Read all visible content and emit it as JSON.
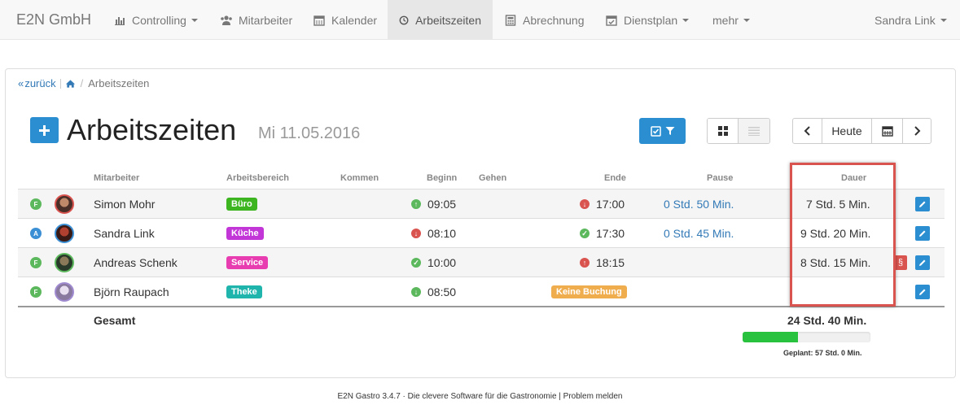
{
  "navbar": {
    "brand": "E2N GmbH",
    "items": [
      {
        "label": "Controlling",
        "icon": "bar-chart-icon",
        "dropdown": true
      },
      {
        "label": "Mitarbeiter",
        "icon": "users-icon",
        "dropdown": false
      },
      {
        "label": "Kalender",
        "icon": "calendar-icon",
        "dropdown": false
      },
      {
        "label": "Arbeitszeiten",
        "icon": "clock-icon",
        "dropdown": false,
        "active": true
      },
      {
        "label": "Abrechnung",
        "icon": "calculator-icon",
        "dropdown": false
      },
      {
        "label": "Dienstplan",
        "icon": "calendar-check-icon",
        "dropdown": true
      },
      {
        "label": "mehr",
        "dropdown": true
      }
    ],
    "user": "Sandra Link"
  },
  "breadcrumb": {
    "back": "zurück",
    "current": "Arbeitszeiten"
  },
  "page": {
    "title": "Arbeitszeiten",
    "date": "Mi 11.05.2016"
  },
  "nav_buttons": {
    "today": "Heute"
  },
  "table": {
    "headers": {
      "mitarbeiter": "Mitarbeiter",
      "arbeitsbereich": "Arbeitsbereich",
      "kommen": "Kommen",
      "beginn": "Beginn",
      "gehen": "Gehen",
      "ende": "Ende",
      "pause": "Pause",
      "dauer": "Dauer"
    },
    "rows": [
      {
        "status": "F",
        "status_color": "#5cb85c",
        "name": "Simon Mohr",
        "area": "Büro",
        "area_color": "#3cb521",
        "beginn": "09:05",
        "beginn_ind": "up",
        "ende": "17:00",
        "ende_ind": "down",
        "pause": "0 Std. 50 Min.",
        "dauer": "7 Std. 5 Min.",
        "para": false
      },
      {
        "status": "A",
        "status_color": "#3b8fd4",
        "name": "Sandra Link",
        "area": "Küche",
        "area_color": "#c236d8",
        "beginn": "08:10",
        "beginn_ind": "down",
        "ende": "17:30",
        "ende_ind": "ok",
        "pause": "0 Std. 45 Min.",
        "dauer": "9 Std. 20 Min.",
        "para": false
      },
      {
        "status": "F",
        "status_color": "#5cb85c",
        "name": "Andreas Schenk",
        "area": "Service",
        "area_color": "#e83cb1",
        "beginn": "10:00",
        "beginn_ind": "ok",
        "ende": "18:15",
        "ende_ind": "up",
        "pause": "",
        "dauer": "8 Std. 15 Min.",
        "para": true,
        "para_label": "§"
      },
      {
        "status": "F",
        "status_color": "#5cb85c",
        "name": "Björn Raupach",
        "area": "Theke",
        "area_color": "#1fb5ad",
        "beginn": "08:50",
        "beginn_ind": "down-green",
        "ende_badge": "Keine Buchung",
        "ende_badge_color": "#f0ad4e",
        "pause": "",
        "dauer": "",
        "para": false
      }
    ],
    "total_label": "Gesamt",
    "total_value": "24 Std. 40 Min.",
    "progress": 0.43,
    "planned": "Geplant: 57 Std. 0 Min."
  },
  "footer": "E2N Gastro 3.4.7 · Die clevere Software für die Gastronomie | Problem melden",
  "colors": {
    "primary": "#2a8ed1",
    "danger": "#d9534f",
    "progress": "#28c23f"
  }
}
